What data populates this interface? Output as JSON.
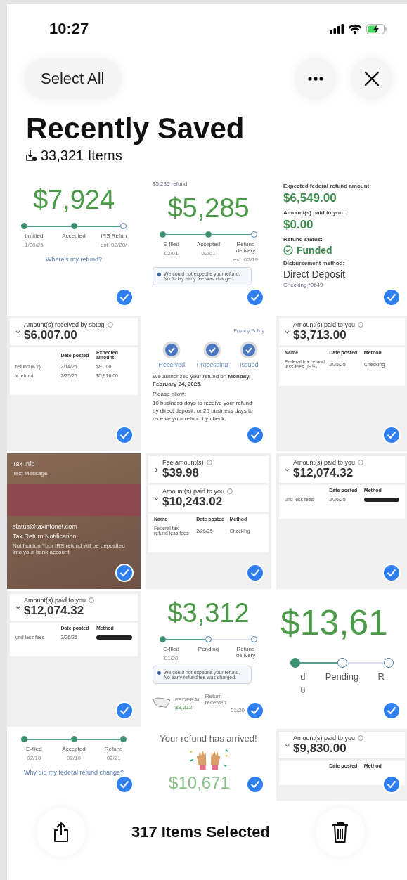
{
  "status_bar": {
    "time": "10:27"
  },
  "toolbar": {
    "select_all": "Select All"
  },
  "title": "Recently Saved",
  "subtitle": "33,321 Items",
  "tiles": [
    {
      "selected": true,
      "kind": "plain",
      "blocks": [
        {
          "kind": "hero",
          "text": "$7,924"
        },
        {
          "kind": "steps",
          "steps": [
            {
              "label": "bmitted",
              "date": "1/30/25",
              "done": true
            },
            {
              "label": "Accepted",
              "done": true
            },
            {
              "label": "IRS Refun",
              "date": "est. 02/20/",
              "done": false
            }
          ]
        },
        {
          "kind": "link",
          "text": "Where's my refund?"
        }
      ]
    },
    {
      "selected": true,
      "kind": "plain",
      "blocks": [
        {
          "kind": "caption",
          "text": "$5,285 refund"
        },
        {
          "kind": "hero",
          "text": "$5,285"
        },
        {
          "kind": "steps",
          "steps": [
            {
              "label": "E-filed",
              "date": "02/01",
              "done": true
            },
            {
              "label": "Accepted",
              "date": "02/01",
              "done": true
            },
            {
              "label": "Refund delivery",
              "date": "est. 02/19",
              "done": false
            }
          ]
        },
        {
          "kind": "note",
          "text": "We could not expedite your refund. No 1-day early fee was charged."
        }
      ]
    },
    {
      "selected": true,
      "kind": "plain",
      "blocks": [
        {
          "kind": "label",
          "text": "Expected federal refund amount:"
        },
        {
          "kind": "green",
          "text": "$6,549.00"
        },
        {
          "kind": "label",
          "text": "Amount(s) paid to you:"
        },
        {
          "kind": "green",
          "text": "$0.00"
        },
        {
          "kind": "label",
          "text": "Refund status:"
        },
        {
          "kind": "status",
          "text": "Funded"
        },
        {
          "kind": "label",
          "text": "Disbursement method:"
        },
        {
          "kind": "plain",
          "text": "Direct Deposit"
        },
        {
          "kind": "caption",
          "text": "Checking *0649"
        }
      ]
    },
    {
      "selected": true,
      "kind": "panel",
      "blocks": [
        {
          "kind": "section",
          "heading": "Amount(s) received by sbtpg",
          "value": "$6,007.00",
          "expanded": true
        },
        {
          "kind": "table",
          "headers": [
            "Date posted",
            "Expected amount"
          ],
          "rows": [
            {
              "cells": [
                "refund (KY)",
                "2/14/25",
                "$91.00"
              ]
            },
            {
              "cells": [
                "x refund",
                "2/25/25",
                "$5,916.00"
              ]
            }
          ]
        }
      ]
    },
    {
      "selected": true,
      "kind": "plain",
      "blocks": [
        {
          "kind": "link_right",
          "text": "Privacy Policy"
        },
        {
          "kind": "checksteps",
          "steps": [
            {
              "label": "Received",
              "done": true
            },
            {
              "label": "Processing",
              "done": true
            },
            {
              "label": "Issued",
              "done": true
            }
          ]
        },
        {
          "kind": "para",
          "text": "We authorized your refund on **Monday, February 24, 2025**."
        },
        {
          "kind": "para",
          "text": "Please allow:"
        },
        {
          "kind": "para",
          "text": "10 business days to receive your refund by direct deposit, or 25 business days to receive your refund by check."
        }
      ]
    },
    {
      "selected": true,
      "kind": "panel",
      "blocks": [
        {
          "kind": "section",
          "heading": "Amount(s) paid to you",
          "value": "$3,713.00",
          "expanded": true
        },
        {
          "kind": "table",
          "headers": [
            "Name",
            "Date posted",
            "Method"
          ],
          "rows": [
            {
              "cells": [
                "Federal tax refund less fees (IRS)",
                "2/25/25",
                "Checking"
              ]
            }
          ]
        }
      ]
    },
    {
      "selected": true,
      "kind": "message",
      "blocks": [
        {
          "kind": "msg_title",
          "text": "Tax Info"
        },
        {
          "kind": "msg_text",
          "text": "Text Message"
        },
        {
          "kind": "redaction"
        },
        {
          "kind": "msg_title",
          "text": "status@taxinfonet.com"
        },
        {
          "kind": "msg_title",
          "text": "Tax Return Notification"
        },
        {
          "kind": "msg_text",
          "text": "Notification Your IRS refund will be deposited into your bank account"
        }
      ]
    },
    {
      "selected": true,
      "kind": "panel",
      "blocks": [
        {
          "kind": "section",
          "heading": "Fee amount(s)",
          "value": "$39.98",
          "expanded": false
        },
        {
          "kind": "section",
          "heading": "Amount(s) paid to you",
          "value": "$10,243.02",
          "expanded": true
        },
        {
          "kind": "table",
          "headers": [
            "Name",
            "Date posted",
            "Method"
          ],
          "rows": [
            {
              "cells": [
                "Federal tax refund less fees",
                "2/26/25",
                "Checking"
              ]
            }
          ]
        }
      ]
    },
    {
      "selected": true,
      "kind": "panel",
      "blocks": [
        {
          "kind": "section",
          "heading": "Amount(s) paid to you",
          "value": "$12,074.32",
          "expanded": true
        },
        {
          "kind": "table",
          "headers": [
            "Date posted",
            "Method"
          ],
          "rows": [
            {
              "cells": [
                "und less fees",
                "2/26/25"
              ],
              "redacted": true
            }
          ]
        }
      ]
    },
    {
      "selected": true,
      "kind": "panel",
      "blocks": [
        {
          "kind": "section",
          "heading": "Amount(s) paid to you",
          "value": "$12,074.32",
          "expanded": true
        },
        {
          "kind": "table",
          "headers": [
            "Date posted",
            "Method"
          ],
          "rows": [
            {
              "cells": [
                "und less fees",
                "2/26/25"
              ],
              "redacted": true
            }
          ]
        }
      ]
    },
    {
      "selected": true,
      "kind": "plain",
      "blocks": [
        {
          "kind": "hero",
          "text": "$3,312"
        },
        {
          "kind": "steps",
          "steps": [
            {
              "label": "E-filed",
              "date": "01/20",
              "done": true
            },
            {
              "label": "Pending",
              "done": false
            },
            {
              "label": "Refund delivery",
              "done": false
            }
          ]
        },
        {
          "kind": "note",
          "text": "We could not expedite your refund. No early refund fee was charged."
        },
        {
          "kind": "federal",
          "label": "FEDERAL",
          "amount": "$3,312",
          "status": "Return received",
          "date": "01/20"
        }
      ]
    },
    {
      "selected": true,
      "kind": "plain",
      "blocks": [
        {
          "kind": "hero_xl",
          "text": "$13,61"
        },
        {
          "kind": "steps_big",
          "steps": [
            {
              "label": "d",
              "date": "0",
              "done": true
            },
            {
              "label": "Pending",
              "done": false
            },
            {
              "label": "R",
              "done": false
            }
          ]
        }
      ]
    },
    {
      "selected": true,
      "kind": "plain",
      "blocks": [
        {
          "kind": "steps",
          "steps": [
            {
              "label": "E-filed",
              "date": "02/10",
              "done": true
            },
            {
              "label": "Accepted",
              "date": "02/10",
              "done": true
            },
            {
              "label": "Refund",
              "date": "02/21",
              "done": true
            }
          ]
        },
        {
          "kind": "link",
          "text": "Why did my federal refund change?"
        }
      ]
    },
    {
      "selected": true,
      "kind": "plain",
      "blocks": [
        {
          "kind": "plain_center",
          "text": "Your refund has arrived!"
        },
        {
          "kind": "hands"
        },
        {
          "kind": "hero_small",
          "text": "$10,671"
        }
      ]
    },
    {
      "selected": true,
      "kind": "panel",
      "blocks": [
        {
          "kind": "section",
          "heading": "Amount(s) paid to you",
          "value": "$9,830.00",
          "expanded": true
        },
        {
          "kind": "table",
          "headers": [
            "Date posted",
            "Method"
          ]
        }
      ]
    }
  ],
  "bottom_bar": {
    "text": "317 Items Selected"
  }
}
